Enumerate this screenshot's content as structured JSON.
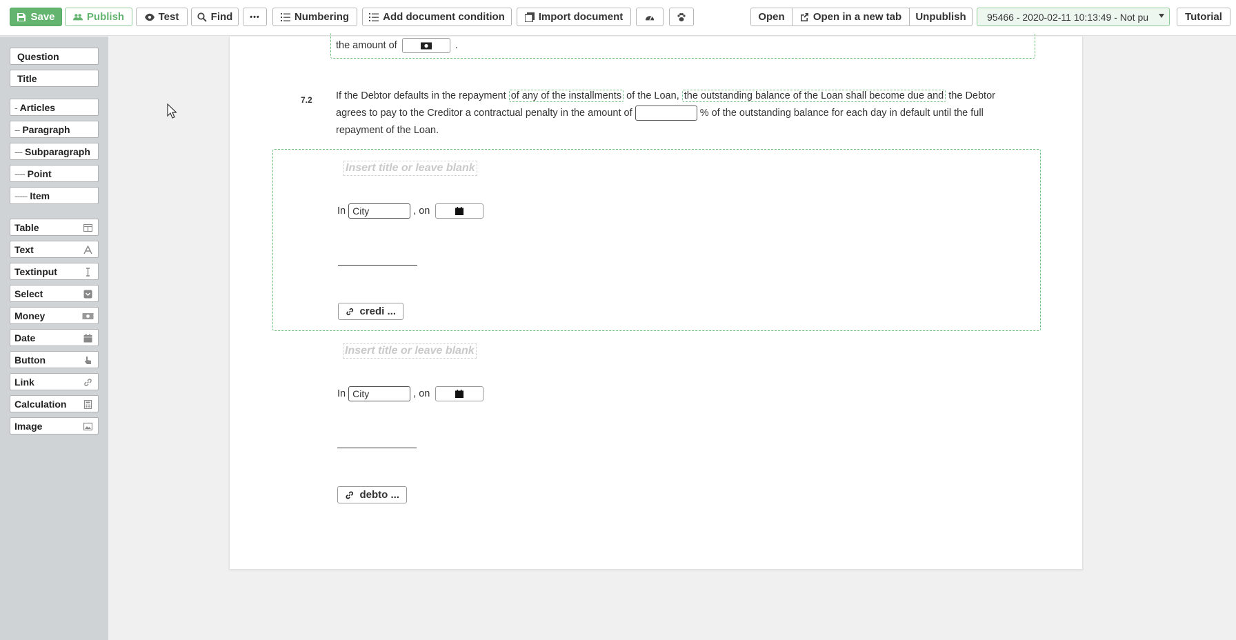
{
  "toolbar": {
    "save": "Save",
    "publish": "Publish",
    "test": "Test",
    "find": "Find",
    "more": "•••",
    "numbering": "Numbering",
    "add_condition": "Add document condition",
    "import": "Import document",
    "open": "Open",
    "open_new_tab": "Open in a new tab",
    "unpublish": "Unpublish",
    "version": "95466 - 2020-02-11 10:13:49 - Not pu",
    "tutorial": "Tutorial"
  },
  "sidebar": {
    "items": [
      {
        "label": "Question",
        "prefix": ""
      },
      {
        "label": "Title",
        "prefix": ""
      },
      {
        "label": "Articles",
        "prefix": "-"
      },
      {
        "label": "Paragraph",
        "prefix": "--"
      },
      {
        "label": "Subparagraph",
        "prefix": "---"
      },
      {
        "label": "Point",
        "prefix": "----"
      },
      {
        "label": "Item",
        "prefix": "-----"
      }
    ],
    "blocks": [
      {
        "label": "Table",
        "icon": "table-icon"
      },
      {
        "label": "Text",
        "icon": "text-icon"
      },
      {
        "label": "Textinput",
        "icon": "text-cursor-icon"
      },
      {
        "label": "Select",
        "icon": "select-icon"
      },
      {
        "label": "Money",
        "icon": "money-icon"
      },
      {
        "label": "Date",
        "icon": "calendar-icon"
      },
      {
        "label": "Button",
        "icon": "pointer-hand-icon"
      },
      {
        "label": "Link",
        "icon": "link-icon"
      },
      {
        "label": "Calculation",
        "icon": "calculator-icon"
      },
      {
        "label": "Image",
        "icon": "image-icon"
      }
    ]
  },
  "document": {
    "top_fragment": {
      "before": "the amount of",
      "after": "."
    },
    "clause": {
      "number": "7.2",
      "line1_a": "If the Debtor defaults in the repayment",
      "cond1": "of any of the installments",
      "line1_b": "of the Loan,",
      "cond2": "the outstanding balance of the Loan shall become due and",
      "line1_c": "the Debtor",
      "line2_a": "agrees to pay to the Creditor a contractual penalty in the amount of",
      "line2_b": "% of the outstanding balance for each day in default until the full",
      "line3": "repayment of the Loan."
    },
    "signature_blocks": [
      {
        "title_placeholder": "Insert title or leave blank",
        "in_label": "In",
        "city": "City",
        "on_label": ", on",
        "link_label": "credi ..."
      },
      {
        "title_placeholder": "Insert title or leave blank",
        "in_label": "In",
        "city": "City",
        "on_label": ", on",
        "link_label": "debto ..."
      }
    ]
  },
  "colors": {
    "accent_green": "#63b46f",
    "sidebar_bg": "#cfd3d6",
    "condition_border": "#6cc07a"
  }
}
